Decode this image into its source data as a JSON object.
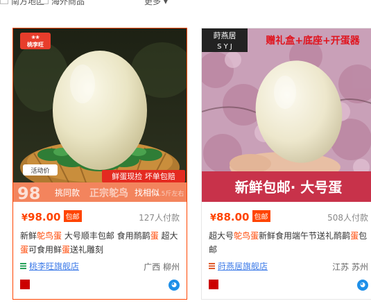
{
  "topbar": {
    "item1": "南方地区",
    "item2": "海外商品",
    "more": "更多 ▾"
  },
  "cards": [
    {
      "brand_logo": "桃李旺",
      "overlay_banner": "鲜蛋现捡 坏单包赔",
      "activity_label": "活动价",
      "activity_price": "98",
      "strip_left": "挑同款",
      "strip_main": "正宗鸵鸟",
      "strip_right": "找相似",
      "strip_weight": "1.5斤左右",
      "price_symbol": "¥",
      "price": "98.00",
      "shipping_tag": "包邮",
      "paid_count": "127人付款",
      "title_parts": [
        "新鲜",
        "鸵鸟蛋",
        " 大号顺丰包邮 食用",
        "鸸鹋",
        "蛋",
        " 超大",
        "蛋",
        "可食用鲜",
        "蛋",
        "送礼雕刻"
      ],
      "shop_name": "桃李旺旗舰店",
      "location": "广西 柳州",
      "colors": {
        "shop_icon": "#27a25b"
      }
    },
    {
      "brand_logo": "莳燕居",
      "brand_sub": "S Y J",
      "gift_banner": "赠礼盒+底座+开蛋器",
      "bottom_banner": "新鲜包邮· 大号蛋",
      "price_symbol": "¥",
      "price": "88.00",
      "shipping_tag": "包邮",
      "paid_count": "508人付款",
      "title_parts": [
        "超大号",
        "鸵鸟蛋",
        "新鲜食用端午节送礼",
        "鸸鹋",
        "蛋",
        "包",
        "",
        "邮",
        "",
        ""
      ],
      "shop_name": "莳燕居旗舰店",
      "location": "江苏 苏州",
      "colors": {
        "shop_icon": "#e05a2b"
      }
    }
  ],
  "colors": {
    "accent": "#ff4400",
    "link": "#3c7ae8"
  }
}
